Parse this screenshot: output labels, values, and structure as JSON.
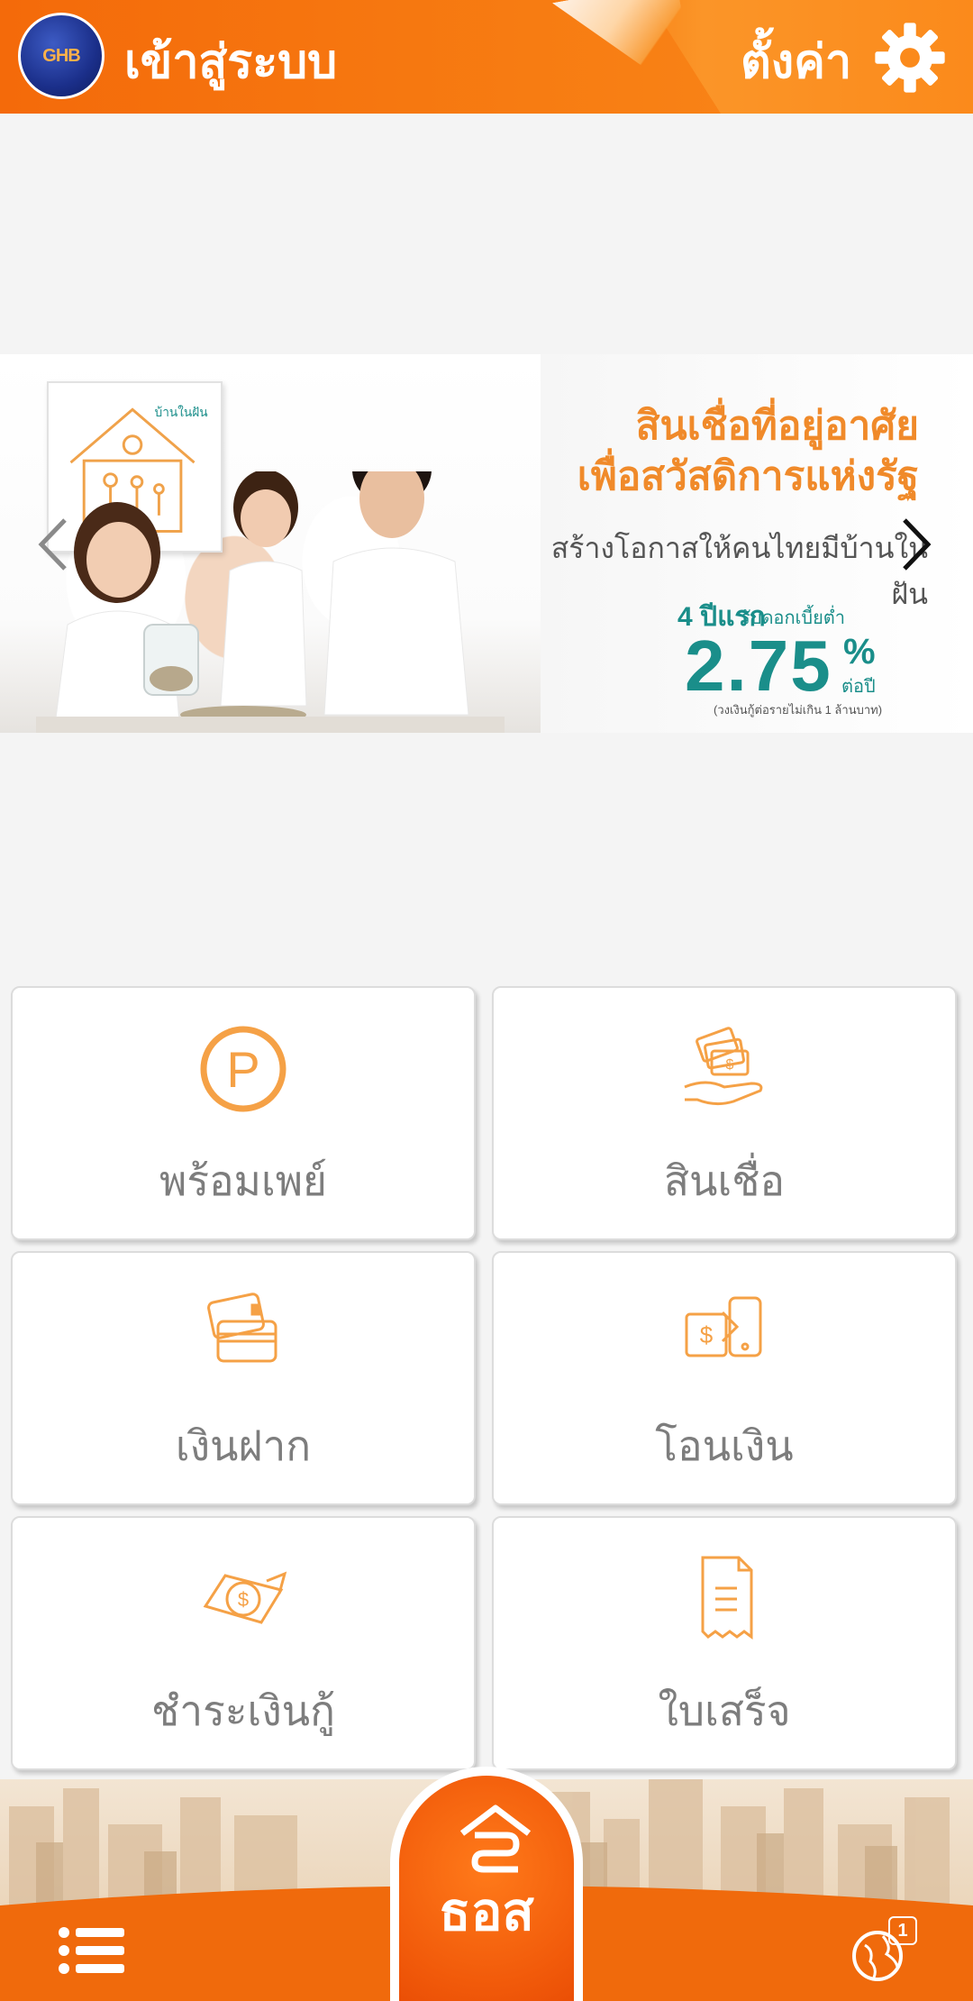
{
  "header": {
    "logo_text": "GHB",
    "title": "เข้าสู่ระบบ",
    "settings_label": "ตั้งค่า",
    "settings_icon": "gear-icon",
    "accent_color": "#f46a0a"
  },
  "banner": {
    "frame_caption": "บ้านในฝัน",
    "headline_line1": "สินเชื่อที่อยู่อาศัย",
    "headline_line2": "เพื่อสวัสดิการแห่งรัฐ",
    "subline": "สร้างโอกาสให้คนไทยมีบ้านในฝัน",
    "promo_years": "4 ปีแรก",
    "promo_small": "รับดอกเบี้ยต่ำ",
    "rate": "2.75",
    "rate_unit": "%",
    "per_year": "ต่อปี",
    "note": "(วงเงินกู้ต่อรายไม่เกิน 1 ล้านบาท)",
    "prev_icon": "chevron-left-icon",
    "next_icon": "chevron-right-icon",
    "text_color": "#1a8e8a",
    "headline_color": "#f08a2a"
  },
  "menu": {
    "items": [
      {
        "label": "พร้อมเพย์",
        "icon": "promptpay-icon"
      },
      {
        "label": "สินเชื่อ",
        "icon": "loan-money-hand-icon"
      },
      {
        "label": "เงินฝาก",
        "icon": "deposit-card-icon"
      },
      {
        "label": "โอนเงิน",
        "icon": "transfer-phone-icon"
      },
      {
        "label": "ชำระเงินกู้",
        "icon": "pay-loan-coin-icon"
      },
      {
        "label": "ใบเสร็จ",
        "icon": "receipt-icon"
      }
    ],
    "icon_color": "#f5a146"
  },
  "bottom_bar": {
    "menu_icon": "list-menu-icon",
    "brand": "ธอส",
    "globe_icon": "globe-icon",
    "notification_count": "1"
  }
}
